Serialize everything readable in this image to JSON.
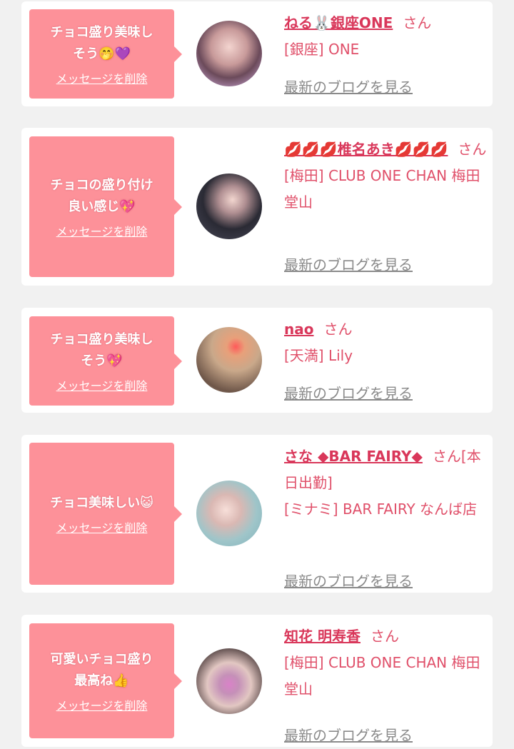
{
  "colors": {
    "background": "#f1f1f1",
    "card": "#ffffff",
    "bubble": "#fd9199",
    "name": "#d9375a",
    "shop": "#e0506a",
    "blog_link": "#8a8a8a"
  },
  "messages": [
    {
      "message": "チョコ盛り美味し\nそう🤭💜",
      "delete_label": "メッセージを削除",
      "name": "ねる🐰銀座ONE",
      "honorific": "さん",
      "shop": "[銀座] ONE",
      "blog_label": "最新のブログを見る"
    },
    {
      "message": "チョコの盛り付け\n良い感じ💖",
      "delete_label": "メッセージを削除",
      "name": "💋💋💋椎名あき💋💋💋",
      "honorific": "さん",
      "shop": "[梅田] CLUB ONE CHAN 梅田堂山",
      "blog_label": "最新のブログを見る"
    },
    {
      "message": "チョコ盛り美味し\nそう💖",
      "delete_label": "メッセージを削除",
      "name": "nao",
      "honorific": "さん",
      "shop": "[天満] Lily",
      "blog_label": "最新のブログを見る"
    },
    {
      "message": "チョコ美味しい😺",
      "delete_label": "メッセージを削除",
      "name": "さな ◆BAR FAIRY◆",
      "honorific": "さん[本日出勤]",
      "shop": "[ミナミ] BAR FAIRY なんば店",
      "blog_label": "最新のブログを見る"
    },
    {
      "message": "可愛いチョコ盛り\n最高ね👍",
      "delete_label": "メッセージを削除",
      "name": "知花 明寿香",
      "honorific": "さん",
      "shop": "[梅田] CLUB ONE CHAN 梅田堂山",
      "blog_label": "最新のブログを見る"
    }
  ]
}
